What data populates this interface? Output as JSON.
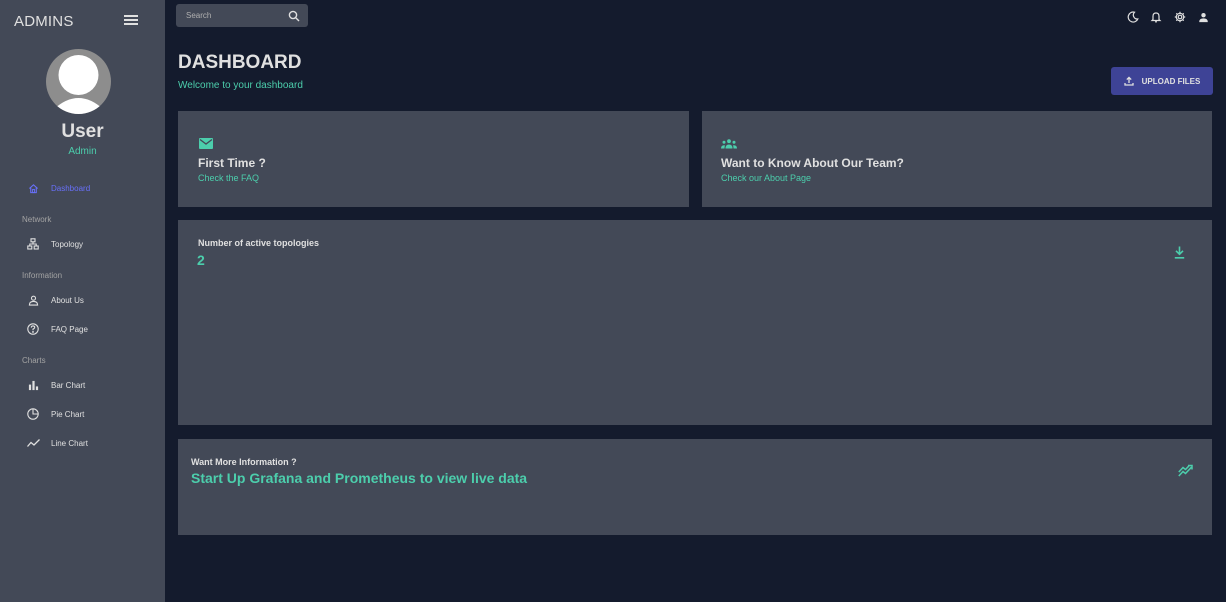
{
  "sidebar": {
    "brand": "ADMINS",
    "user": {
      "name": "User",
      "role": "Admin"
    },
    "items": [
      {
        "label": "Dashboard",
        "icon": "home-icon",
        "active": true
      },
      {
        "label": "Topology",
        "icon": "sitemap-icon"
      },
      {
        "label": "About Us",
        "icon": "person-icon"
      },
      {
        "label": "FAQ Page",
        "icon": "help-circle-icon"
      },
      {
        "label": "Bar Chart",
        "icon": "bar-chart-icon"
      },
      {
        "label": "Pie Chart",
        "icon": "pie-chart-icon"
      },
      {
        "label": "Line Chart",
        "icon": "line-chart-icon"
      }
    ],
    "sections": [
      "Network",
      "Information",
      "Charts"
    ]
  },
  "topbar": {
    "search_placeholder": "Search",
    "icons": [
      "dark-mode-icon",
      "notifications-icon",
      "settings-icon",
      "person-icon"
    ]
  },
  "header": {
    "title": "DASHBOARD",
    "subtitle": "Welcome to your dashboard",
    "upload_label": "UPLOAD FILES"
  },
  "cards": {
    "faq": {
      "title": "First Time ?",
      "link": "Check the FAQ",
      "icon": "email-icon"
    },
    "team": {
      "title": "Want to Know About Our Team?",
      "link": "Check our About Page",
      "icon": "groups-icon"
    },
    "topologies": {
      "label": "Number of active topologies",
      "value": "2",
      "icon": "download-icon"
    },
    "info": {
      "label": "Want More Information ?",
      "link": "Start Up Grafana and Prometheus to view live data",
      "icon": "trending-icon"
    }
  },
  "colors": {
    "background": "#141b2d",
    "panel": "#434957",
    "accent_green": "#4cceac",
    "accent_blue": "#6870fa",
    "button": "#3e4396"
  }
}
